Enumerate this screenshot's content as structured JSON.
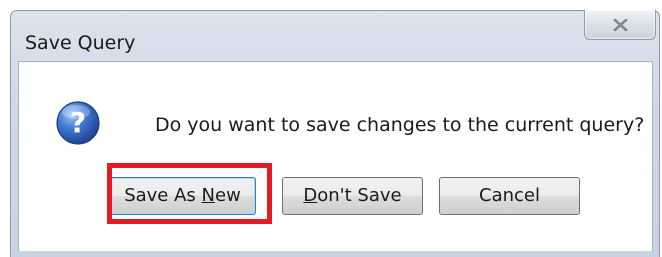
{
  "dialog": {
    "title": "Save Query",
    "message": "Do you want to save changes to the current query?",
    "icon": "question-icon",
    "close_icon": "close-icon"
  },
  "buttons": {
    "save_as_new": {
      "pre": "Save As ",
      "mnemonic": "N",
      "post": "ew"
    },
    "dont_save": {
      "pre": "",
      "mnemonic": "D",
      "post": "on't Save"
    },
    "cancel": {
      "pre": "Cancel",
      "mnemonic": "",
      "post": ""
    }
  },
  "colors": {
    "highlight": "#e21b24",
    "question_icon": "#2f5fb8"
  }
}
